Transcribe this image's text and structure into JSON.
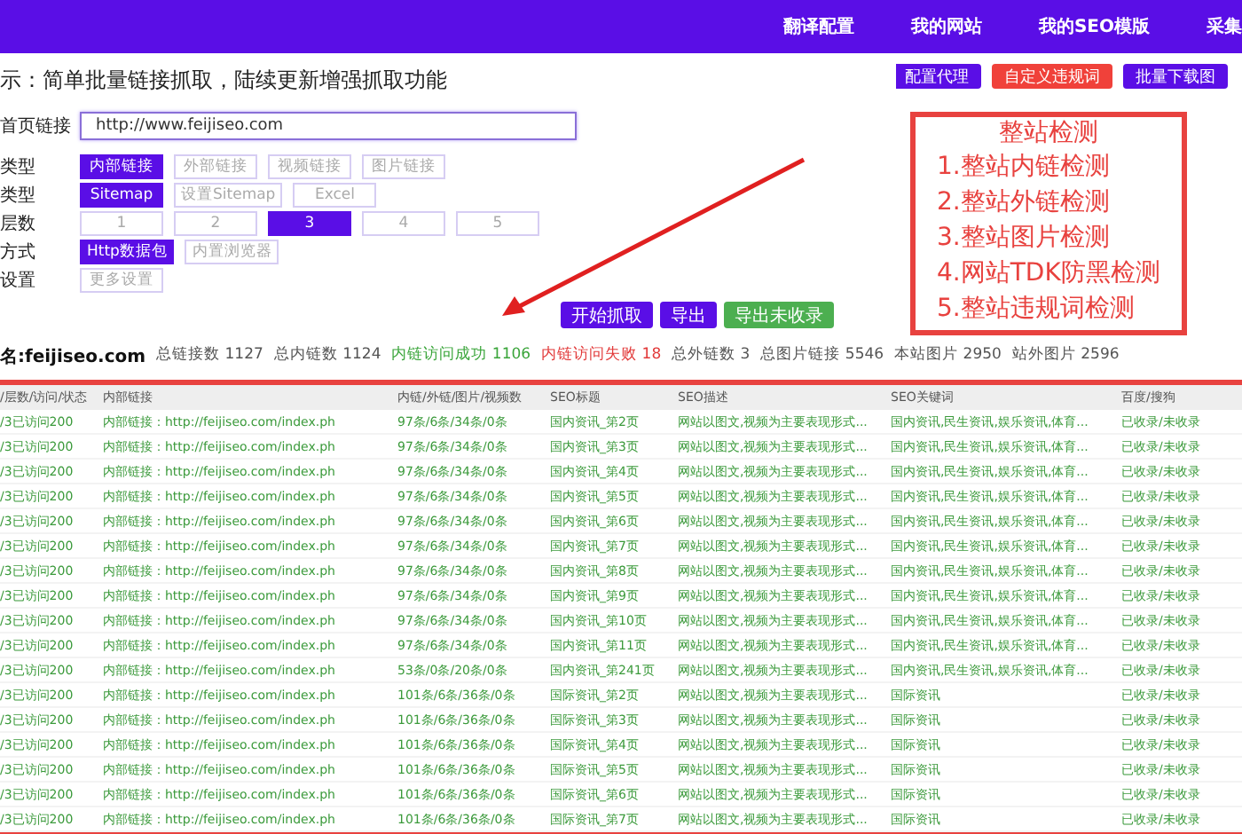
{
  "nav": {
    "items": [
      "翻译配置",
      "我的网站",
      "我的SEO模版",
      "采集"
    ]
  },
  "notice": "示：简单批量链接抓取，陆续更新增强抓取功能",
  "top_buttons": [
    {
      "label": "配置代理",
      "kind": "primary"
    },
    {
      "label": "自定义违规词",
      "kind": "danger"
    },
    {
      "label": "批量下载图",
      "kind": "primary"
    }
  ],
  "form": {
    "url_label": "首页链接",
    "url_value": "http://www.feijiseo.com",
    "rows": [
      {
        "label": "类型",
        "options": [
          {
            "label": "内部链接",
            "selected": true
          },
          {
            "label": "外部链接",
            "selected": false
          },
          {
            "label": "视频链接",
            "selected": false
          },
          {
            "label": "图片链接",
            "selected": false
          }
        ]
      },
      {
        "label": "类型",
        "options": [
          {
            "label": "Sitemap",
            "selected": true
          },
          {
            "label": "设置Sitemap",
            "selected": false
          },
          {
            "label": "Excel",
            "selected": false
          }
        ]
      },
      {
        "label": "层数",
        "options": [
          {
            "label": "1",
            "selected": false
          },
          {
            "label": "2",
            "selected": false
          },
          {
            "label": "3",
            "selected": true
          },
          {
            "label": "4",
            "selected": false
          },
          {
            "label": "5",
            "selected": false
          }
        ]
      },
      {
        "label": "方式",
        "options": [
          {
            "label": "Http数据包",
            "selected": true
          },
          {
            "label": "内置浏览器",
            "selected": false
          }
        ]
      },
      {
        "label": "设置",
        "options": [
          {
            "label": "更多设置",
            "selected": false
          }
        ]
      }
    ]
  },
  "actions": [
    {
      "label": "开始抓取",
      "kind": "primary"
    },
    {
      "label": "导出",
      "kind": "primary"
    },
    {
      "label": "导出未收录",
      "kind": "success"
    }
  ],
  "stats": [
    {
      "text": "名:feijiseo.com",
      "kind": "domain"
    },
    {
      "text": "总链接数 1127",
      "kind": "normal"
    },
    {
      "text": "总内链数 1124",
      "kind": "normal"
    },
    {
      "text": "内链访问成功 1106",
      "kind": "success"
    },
    {
      "text": "内链访问失败 18",
      "kind": "danger"
    },
    {
      "text": "总外链数 3",
      "kind": "normal"
    },
    {
      "text": "总图片链接 5546",
      "kind": "normal"
    },
    {
      "text": "本站图片 2950",
      "kind": "normal"
    },
    {
      "text": "站外图片 2596",
      "kind": "normal"
    }
  ],
  "callout": {
    "title": "整站检测",
    "items": [
      "1.整站内链检测",
      "2.整站外链检测",
      "3.整站图片检测",
      "4.网站TDK防黑检测",
      "5.整站违规词检测"
    ]
  },
  "table": {
    "columns": [
      "/层数/访问/状态",
      "内部链接",
      "内链/外链/图片/视频数",
      "SEO标题",
      "SEO描述",
      "SEO关键词",
      "百度/搜狗"
    ],
    "rows": [
      [
        "/3已访问200",
        "内部链接：http://feijiseo.com/index.ph",
        "97条/6条/34条/0条",
        "国内资讯_第2页",
        "网站以图文,视频为主要表现形式...",
        "国内资讯,民生资讯,娱乐资讯,体育...",
        "已收录/未收录"
      ],
      [
        "/3已访问200",
        "内部链接：http://feijiseo.com/index.ph",
        "97条/6条/34条/0条",
        "国内资讯_第3页",
        "网站以图文,视频为主要表现形式...",
        "国内资讯,民生资讯,娱乐资讯,体育...",
        "已收录/未收录"
      ],
      [
        "/3已访问200",
        "内部链接：http://feijiseo.com/index.ph",
        "97条/6条/34条/0条",
        "国内资讯_第4页",
        "网站以图文,视频为主要表现形式...",
        "国内资讯,民生资讯,娱乐资讯,体育...",
        "已收录/未收录"
      ],
      [
        "/3已访问200",
        "内部链接：http://feijiseo.com/index.ph",
        "97条/6条/34条/0条",
        "国内资讯_第5页",
        "网站以图文,视频为主要表现形式...",
        "国内资讯,民生资讯,娱乐资讯,体育...",
        "已收录/未收录"
      ],
      [
        "/3已访问200",
        "内部链接：http://feijiseo.com/index.ph",
        "97条/6条/34条/0条",
        "国内资讯_第6页",
        "网站以图文,视频为主要表现形式...",
        "国内资讯,民生资讯,娱乐资讯,体育...",
        "已收录/未收录"
      ],
      [
        "/3已访问200",
        "内部链接：http://feijiseo.com/index.ph",
        "97条/6条/34条/0条",
        "国内资讯_第7页",
        "网站以图文,视频为主要表现形式...",
        "国内资讯,民生资讯,娱乐资讯,体育...",
        "已收录/未收录"
      ],
      [
        "/3已访问200",
        "内部链接：http://feijiseo.com/index.ph",
        "97条/6条/34条/0条",
        "国内资讯_第8页",
        "网站以图文,视频为主要表现形式...",
        "国内资讯,民生资讯,娱乐资讯,体育...",
        "已收录/未收录"
      ],
      [
        "/3已访问200",
        "内部链接：http://feijiseo.com/index.ph",
        "97条/6条/34条/0条",
        "国内资讯_第9页",
        "网站以图文,视频为主要表现形式...",
        "国内资讯,民生资讯,娱乐资讯,体育...",
        "已收录/未收录"
      ],
      [
        "/3已访问200",
        "内部链接：http://feijiseo.com/index.ph",
        "97条/6条/34条/0条",
        "国内资讯_第10页",
        "网站以图文,视频为主要表现形式...",
        "国内资讯,民生资讯,娱乐资讯,体育...",
        "已收录/未收录"
      ],
      [
        "/3已访问200",
        "内部链接：http://feijiseo.com/index.ph",
        "97条/6条/34条/0条",
        "国内资讯_第11页",
        "网站以图文,视频为主要表现形式...",
        "国内资讯,民生资讯,娱乐资讯,体育...",
        "已收录/未收录"
      ],
      [
        "/3已访问200",
        "内部链接：http://feijiseo.com/index.ph",
        "53条/0条/20条/0条",
        "国内资讯_第241页",
        "网站以图文,视频为主要表现形式...",
        "国内资讯,民生资讯,娱乐资讯,体育...",
        "已收录/未收录"
      ],
      [
        "/3已访问200",
        "内部链接：http://feijiseo.com/index.ph",
        "101条/6条/36条/0条",
        "国际资讯_第2页",
        "网站以图文,视频为主要表现形式...",
        "国际资讯",
        "已收录/未收录"
      ],
      [
        "/3已访问200",
        "内部链接：http://feijiseo.com/index.ph",
        "101条/6条/36条/0条",
        "国际资讯_第3页",
        "网站以图文,视频为主要表现形式...",
        "国际资讯",
        "已收录/未收录"
      ],
      [
        "/3已访问200",
        "内部链接：http://feijiseo.com/index.ph",
        "101条/6条/36条/0条",
        "国际资讯_第4页",
        "网站以图文,视频为主要表现形式...",
        "国际资讯",
        "已收录/未收录"
      ],
      [
        "/3已访问200",
        "内部链接：http://feijiseo.com/index.ph",
        "101条/6条/36条/0条",
        "国际资讯_第5页",
        "网站以图文,视频为主要表现形式...",
        "国际资讯",
        "已收录/未收录"
      ],
      [
        "/3已访问200",
        "内部链接：http://feijiseo.com/index.ph",
        "101条/6条/36条/0条",
        "国际资讯_第6页",
        "网站以图文,视频为主要表现形式...",
        "国际资讯",
        "已收录/未收录"
      ],
      [
        "/3已访问200",
        "内部链接：http://feijiseo.com/index.ph",
        "101条/6条/36条/0条",
        "国际资讯_第7页",
        "网站以图文,视频为主要表现形式...",
        "国际资讯",
        "已收录/未收录"
      ]
    ]
  }
}
